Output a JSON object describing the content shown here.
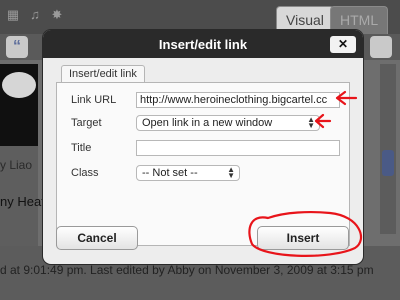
{
  "editor": {
    "toolbar_icons": [
      "format-icon",
      "music-icon",
      "gear-icon"
    ],
    "tabs": [
      {
        "label": "Visual"
      },
      {
        "label": "HTML"
      }
    ],
    "quote_button": "“",
    "content_fragment_1": "y Liao",
    "content_fragment_2": "ny Heat",
    "status_text": "d at 9:01:49 pm. Last edited by Abby on November 3, 2009 at 3:15 pm"
  },
  "dialog": {
    "title": "Insert/edit link",
    "close_label": "✕",
    "tab_label": "Insert/edit link",
    "fields": {
      "link_url_label": "Link URL",
      "link_url_value": "http://www.heroineclothing.bigcartel.cc",
      "target_label": "Target",
      "target_value": "Open link in a new window",
      "title_label": "Title",
      "title_value": "",
      "class_label": "Class",
      "class_value": "-- Not set --"
    },
    "buttons": {
      "cancel_label": "Cancel",
      "insert_label": "Insert"
    }
  },
  "colors": {
    "annotation": "#e8141a",
    "dialog_titlebar": "#2a2a2a"
  }
}
